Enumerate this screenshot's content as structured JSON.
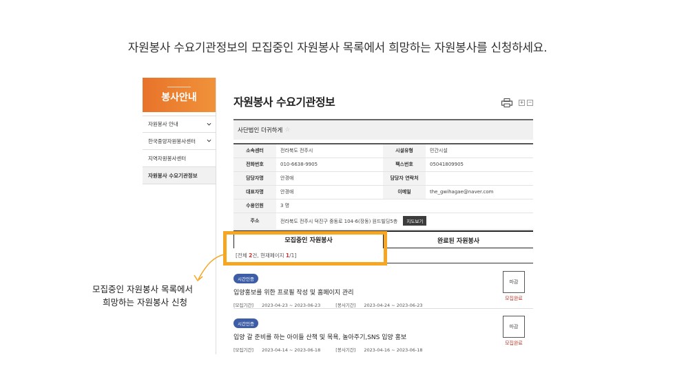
{
  "instruction": "자원봉사 수요기관정보의 모집중인 자원봉사 목록에서 희망하는 자원봉사를 신청하세요.",
  "sidebar": {
    "title": "봉사안내",
    "items": [
      {
        "label": "자원봉사 안내",
        "expandable": true
      },
      {
        "label": "한국중앙자원봉사센터",
        "expandable": true
      },
      {
        "label": "지역자원봉사센터",
        "expandable": false
      },
      {
        "label": "자원봉사 수요기관정보",
        "expandable": false,
        "active": true
      }
    ]
  },
  "page": {
    "title": "자원봉사 수요기관정보",
    "zoom_in": "+",
    "zoom_out": "−"
  },
  "org": {
    "name": "사단법인 더귀하게",
    "star": "☆"
  },
  "info": {
    "affiliation_label": "소속센터",
    "affiliation": "전라북도 전주시",
    "facility_type_label": "시설유형",
    "facility_type": "민간시설",
    "phone_label": "전화번호",
    "phone": "010-6638-9905",
    "fax_label": "팩스번호",
    "fax": "05041809905",
    "manager_label": "담당자명",
    "manager": "안경애",
    "manager_contact_label": "담당자 연락처",
    "manager_contact": "",
    "rep_label": "대표자명",
    "rep": "안경애",
    "email_label": "이메일",
    "email": "the_gwihagae@naver.com",
    "capacity_label": "수용인원",
    "capacity": "3 명",
    "address_label": "주소",
    "address": "전라북도 전주시 덕진구 중동로 104-6(장동)  원드빌딩5층",
    "map_button": "지도보기"
  },
  "tabs": {
    "recruiting": "모집중인 자원봉사",
    "completed": "완료된 자원봉사"
  },
  "count": {
    "prefix": "[전체 ",
    "total": "2",
    "middle": "건, 현재페이지 ",
    "current": "1",
    "suffix": "/1]"
  },
  "items": [
    {
      "badge": "시간인증",
      "title": "입양홍보를 위한 프로필 작성 및 홈페이지 관리",
      "recruit_label": "[모집기간]",
      "recruit": "2023-04-23 ~ 2023-06-23",
      "service_label": "[봉사기간]",
      "service": "2023-04-24 ~ 2023-06-23",
      "status_box": "마감",
      "status": "모집완료"
    },
    {
      "badge": "시간인증",
      "title": "입양 갈 준비를 하는 아이들 산책 및 목욕, 놀아주기,SNS 입양 홍보",
      "recruit_label": "[모집기간]",
      "recruit": "2023-04-14 ~ 2023-06-18",
      "service_label": "[봉사기간]",
      "service": "2023-04-16 ~ 2023-06-18",
      "status_box": "마감",
      "status": "모집완료"
    }
  ],
  "callout": {
    "line1": "모집중인 자원봉사 목록에서",
    "line2": "희망하는 자원봉사 신청"
  },
  "colors": {
    "accent": "#e8732a",
    "highlight": "#f5a623",
    "badge": "#3d5ea6",
    "status": "#c0392b"
  }
}
